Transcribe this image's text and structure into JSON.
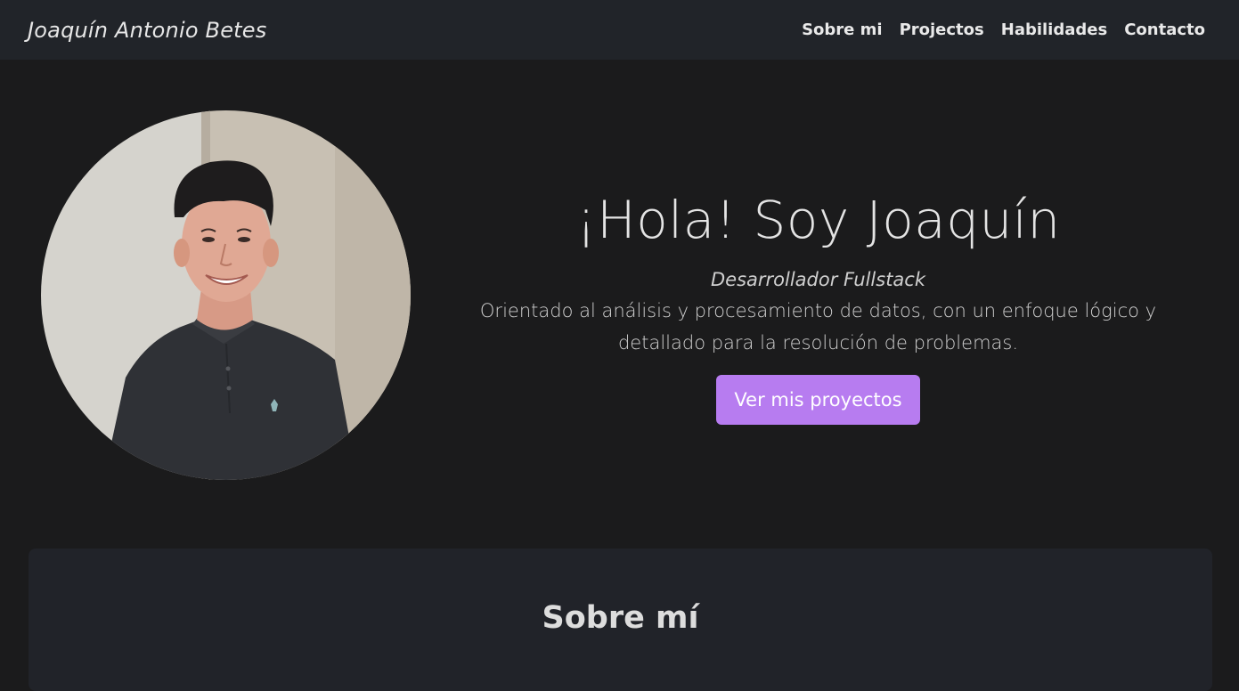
{
  "navbar": {
    "brand": "Joaquín Antonio Betes",
    "links": [
      "Sobre mi",
      "Projectos",
      "Habilidades",
      "Contacto"
    ]
  },
  "hero": {
    "title": "¡Hola! Soy Joaquín",
    "subtitle": "Desarrollador Fullstack",
    "description": "Orientado al análisis y procesamiento de datos, con un enfoque lógico y detallado para la resolución de problemas.",
    "cta_label": "Ver mis proyectos"
  },
  "about": {
    "title": "Sobre mí"
  },
  "colors": {
    "background": "#1b1b1c",
    "navbar": "#212429",
    "accent": "#b77cf0",
    "card": "#212329"
  }
}
